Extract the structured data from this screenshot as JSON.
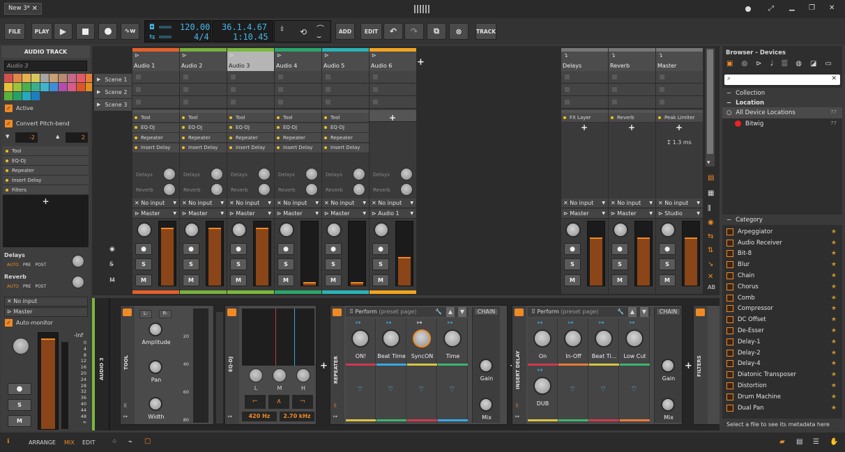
{
  "title": {
    "doc_tab": "New 3*"
  },
  "toolbar": {
    "file": "FILE",
    "play": "PLAY",
    "add": "ADD",
    "edit": "EDIT",
    "track": "TRACK",
    "tempo": "120.00",
    "signature": "4/4",
    "position": "36.1.4.67",
    "time": "1:10.45"
  },
  "left_panel": {
    "title": "AUDIO TRACK",
    "track_name": "Audio 3",
    "active": "Active",
    "convert": "Convert Pitch-bend",
    "pb_down": "-2",
    "pb_up": "2",
    "devices": [
      "Tool",
      "EQ-DJ",
      "Repeater",
      "Insert Delay",
      "Filters"
    ],
    "send1": "Delays",
    "send2": "Reverb",
    "auto": "AUTO",
    "pre": "PRE",
    "post": "POST",
    "input": "No input",
    "output": "Master",
    "auto_monitor": "Auto-monitor",
    "meter_label": "-Inf",
    "scale": [
      "0",
      "4",
      "8",
      "12",
      "16",
      "20",
      "24",
      "28",
      "32",
      "36",
      "40",
      "44",
      "48",
      "∞"
    ],
    "palette": [
      "#d45050",
      "#e08848",
      "#e5b04f",
      "#d6c75c",
      "#a7a4a4",
      "#c9a074",
      "#b88a6e",
      "#c26a8a",
      "#e25a6a",
      "#e77b37",
      "#e7c13a",
      "#9cc33a",
      "#4ab04d",
      "#39b08d",
      "#3fb4cf",
      "#3c8fd6",
      "#b04eb0",
      "#d75c8c",
      "#e0542a",
      "#e08f1e",
      "#5ab03a",
      "#28a068",
      "#27a9bd",
      "#1e7ec2"
    ]
  },
  "mixer": {
    "tracks": [
      {
        "name": "Audio 1",
        "color": "#e2602b",
        "devices": [
          "Tool",
          "EQ-DJ",
          "Repeater",
          "Insert Delay"
        ],
        "input": "No input",
        "output": "Master",
        "level": 0.9
      },
      {
        "name": "Audio 2",
        "color": "#78b03c",
        "devices": [
          "Tool",
          "EQ-DJ",
          "Repeater",
          "Insert Delay"
        ],
        "input": "No input",
        "output": "Master",
        "level": 0.9
      },
      {
        "name": "Audio 3",
        "color": "#7ab83d",
        "devices": [
          "Tool",
          "EQ-DJ",
          "Repeater",
          "Insert Delay"
        ],
        "input": "No input",
        "output": "Master",
        "level": 0.9
      },
      {
        "name": "Audio 4",
        "color": "#2aa56c",
        "devices": [
          "Tool",
          "EQ-DJ",
          "Repeater",
          "Insert Delay"
        ],
        "input": "No input",
        "output": "Master",
        "level": 0.05
      },
      {
        "name": "Audio 5",
        "color": "#2ab3b6",
        "devices": [
          "Tool",
          "EQ-DJ",
          "Repeater",
          "Insert Delay"
        ],
        "input": "No input",
        "output": "Master",
        "level": 0.05
      },
      {
        "name": "Audio 6",
        "color": "#f1a51f",
        "devices": [],
        "input": "No input",
        "output": "Audio 1",
        "level": 0.45
      }
    ],
    "fx_tracks": [
      {
        "name": "Delays",
        "device": "FX Layer",
        "input": "No input",
        "output": "Master",
        "level": 0.75
      },
      {
        "name": "Reverb",
        "device": "Reverb",
        "input": "No input",
        "output": "Master",
        "level": 0.75
      },
      {
        "name": "Master",
        "device": "Peak Limiter",
        "input": "No input",
        "output": "Studio",
        "level": 0.75,
        "latency": "Σ 1.3 ms"
      }
    ],
    "scenes": [
      "Scene 1",
      "Scene 2",
      "Scene 3"
    ],
    "send_labels": [
      "Delays",
      "Reverb"
    ],
    "s": "S",
    "m": "M"
  },
  "chain": {
    "track_label": "AUDIO 3",
    "tool": {
      "label": "TOOL",
      "l": "L-",
      "r": "R-",
      "amplitude": "Amplitude",
      "pan": "Pan",
      "width": "Width",
      "scale": [
        "20",
        "40",
        "60",
        "80"
      ]
    },
    "eq": {
      "label": "EQ-DJ",
      "bands": [
        "L",
        "M",
        "H"
      ],
      "f1": "420 Hz",
      "f2": "2.70 kHz"
    },
    "repeater": {
      "label": "REPEATER",
      "page": "Perform",
      "page_hint": "(preset page)",
      "macros": [
        "ON!",
        "Beat Time",
        "SyncON",
        "Time"
      ],
      "chain": "CHAIN",
      "gain": "Gain",
      "mix": "Mix"
    },
    "insert_delay": {
      "label": "INSERT DELAY",
      "page": "Perform",
      "page_hint": "(preset page)",
      "macros": [
        "On",
        "In-Off",
        "Beat Ti...",
        "Low Cut"
      ],
      "dub": "DUB",
      "chain": "CHAIN",
      "gain": "Gain",
      "mix": "Mix"
    },
    "filters": {
      "label": "FILTERS"
    }
  },
  "browser": {
    "title": "Browser - Devices",
    "collection": "Collection",
    "location": "Location",
    "all_locations": "All Device Locations",
    "all_count": "77",
    "bitwig": "Bitwig",
    "bitwig_count": "77",
    "category": "Category",
    "categories": [
      "Arpeggiator",
      "Audio Receiver",
      "Bit-8",
      "Blur",
      "Chain",
      "Chorus",
      "Comb",
      "Compressor",
      "DC Offset",
      "De-Esser",
      "Delay-1",
      "Delay-2",
      "Delay-4",
      "Diatonic Transposer",
      "Distortion",
      "Drum Machine",
      "Dual Pan"
    ],
    "footer": "Select a file to see its metadata here"
  },
  "status": {
    "arrange": "ARRANGE",
    "mix": "MIX",
    "edit": "EDIT"
  },
  "colors": {
    "accent": "#f08a24",
    "lcd": "#46b7e8"
  }
}
